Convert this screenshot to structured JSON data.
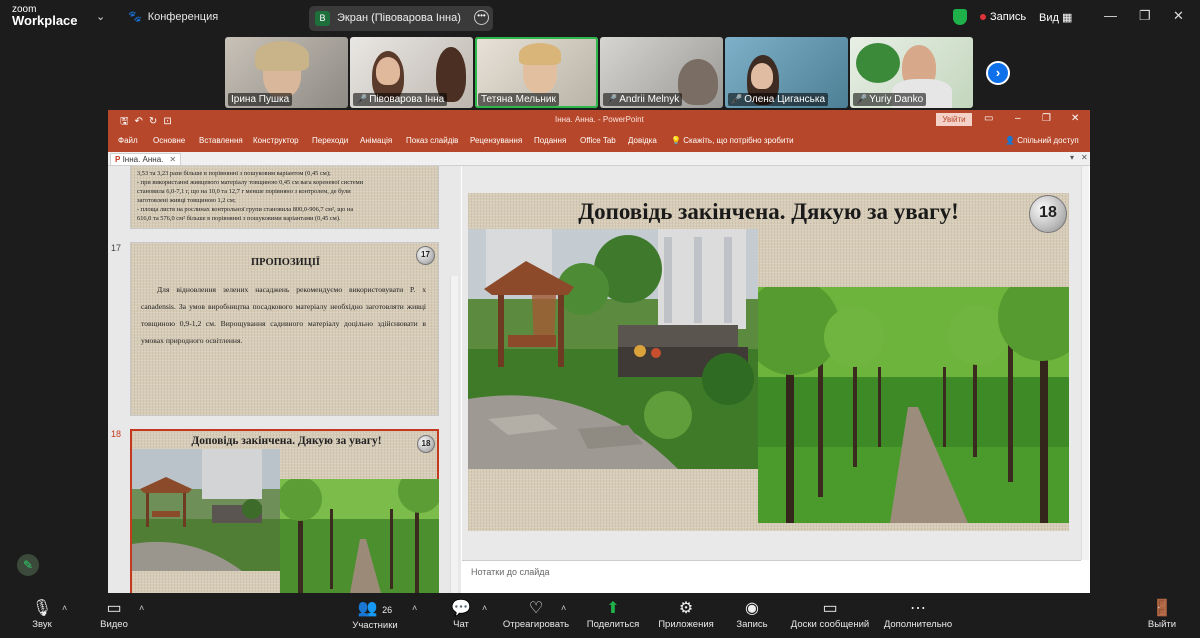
{
  "app": {
    "logo_top": "zoom",
    "logo_bottom": "Workplace"
  },
  "topbar": {
    "conference": "Конференция",
    "screen_badge": "B",
    "screen_label": "Экран (Півоварова Інна)",
    "recording": "Запись",
    "view": "Вид"
  },
  "participants": [
    {
      "name": "Ірина Пушка",
      "muted": false
    },
    {
      "name": "Півоварова Інна",
      "muted": true
    },
    {
      "name": "Тетяна Мельник",
      "muted": false
    },
    {
      "name": "Andrii Melnyk",
      "muted": true
    },
    {
      "name": "Олена Циганська",
      "muted": true
    },
    {
      "name": "Yuriy Danko",
      "muted": true
    }
  ],
  "ppt": {
    "window_title": "Інна. Анна.  -  PowerPoint",
    "login": "Увійти",
    "ribbon_tabs": [
      "Файл",
      "Основне",
      "Вставлення",
      "Конструктор",
      "Переходи",
      "Анімація",
      "Показ слайдів",
      "Рецензування",
      "Подання",
      "Office Tab",
      "Довідка"
    ],
    "tell_me": "Скажіть, що потрібно зробити",
    "share": "Спільний доступ",
    "doc_tab": "Інна. Анна.",
    "notes_placeholder": "Нотатки до слайда"
  },
  "thumbnails": {
    "prev_text": [
      "3,53 та 3,23 рази більше в порівнянні з пошуковим варіантом (0,45 см);",
      "- при використанні живцевого матеріалу товщиною 0,45 см вага кореневої системи",
      "становила 6,0-7,1 г, що на 10,0 та 12,7 г менше порівняно з контролем, де були",
      "заготовлені живці товщиною 1,2 см;",
      "- площа листя на рослинах контрольної групи становила 800,0-906,7 см², що на",
      "616,0 та 576,0 см² більше в порівнянні з пошуковими варіантами (0,45 см)."
    ],
    "slide17": {
      "number": "17",
      "badge": "17",
      "title": "ПРОПОЗИЦІЇ",
      "body": "Для відновлення зелених насаджень рекомендуємо використовувати P. x canadensis. За умов виробництва посадкового матеріалу необхідно заготовляти живці товщиною 0,9-1,2 см. Вирощування садивного матеріалу доцільно здійснювати в умовах природного освітлення."
    },
    "slide18": {
      "number": "18",
      "badge": "18",
      "title": "Доповідь закінчена.  Дякую за увагу!"
    }
  },
  "main_slide": {
    "title": "Доповідь закінчена.  Дякую за увагу!",
    "badge": "18"
  },
  "bottombar": {
    "audio": "Звук",
    "video": "Видео",
    "participants": "Участники",
    "participants_count": "26",
    "chat": "Чат",
    "react": "Отреагировать",
    "share": "Поделиться",
    "apps": "Приложения",
    "record": "Запись",
    "whiteboards": "Доски сообщений",
    "more": "Дополнительно",
    "leave": "Выйти"
  },
  "colors": {
    "zoom_bg": "#1c1c1c",
    "ppt_accent": "#b7472a",
    "active_speaker": "#2db84c",
    "share_green": "#1fb14a",
    "zoom_blue": "#0e71eb"
  }
}
